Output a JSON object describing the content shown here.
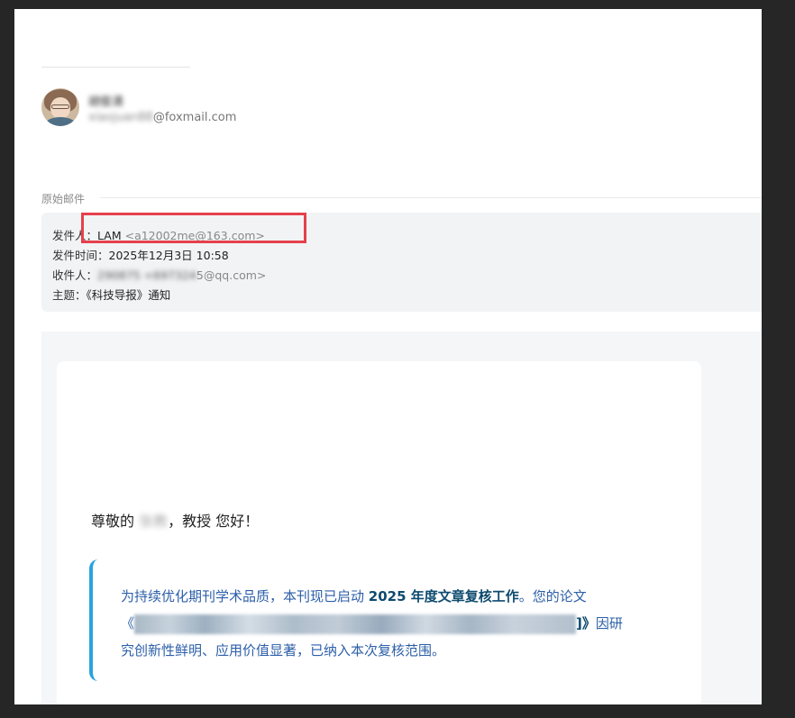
{
  "sender": {
    "name": "胡俊清",
    "email_hidden": "xiaojuan88",
    "email_domain": "@foxmail.com"
  },
  "original_mail": {
    "section_label": "原始邮件",
    "from_label": "发件人：",
    "from_name": "LAM",
    "from_email": "<a12002me@163.com>",
    "time_label": "发件时间：",
    "time_value": "2025年12月3日 10:58",
    "to_label": "收件人：",
    "to_name_hidden": "290875",
    "to_email_prefix_hidden": "<697324",
    "to_email_suffix": "5@qq.com>",
    "subject_label": "主题：",
    "subject_value": "《科技导报》通知"
  },
  "body": {
    "greeting_prefix": "尊敬的 ",
    "greeting_name_hidden": "张教",
    "greeting_suffix": "，教授 您好！",
    "para_part1": "为持续优化期刊学术品质，本刊现已启动 ",
    "para_bold": "2025 年度文章复核工作",
    "para_part2": "。您的论文",
    "title_open": "《",
    "title_close_bold": "]》",
    "para_part3": "因研究创新性鲜明、应用价值显著，已纳入本次复核范围。"
  },
  "colors": {
    "highlight_border": "#e5404c",
    "quote_border": "#2aa3dd",
    "quote_text": "#2c5fa8"
  }
}
